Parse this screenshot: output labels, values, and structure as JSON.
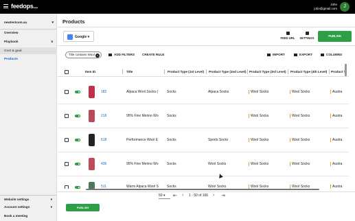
{
  "topbar": {
    "logo": "feedops...",
    "user_name": "John",
    "user_email": "john@gmail.com",
    "avatar_initial": "J"
  },
  "sidebar": {
    "site": "newtestcom.au",
    "items": [
      {
        "label": "Overview",
        "count": ""
      },
      {
        "label": "Playbook",
        "count": "5"
      },
      {
        "label": "Cost & goal",
        "count": ""
      },
      {
        "label": "Products",
        "count": ""
      }
    ],
    "bottom": [
      {
        "label": "Website settings"
      },
      {
        "label": "Account settings"
      },
      {
        "label": "Book a meeting"
      }
    ]
  },
  "page": {
    "title": "Products"
  },
  "toolbar": {
    "channel": "Google",
    "feed_url": "FEED URL",
    "settings": "SETTINGS",
    "publish": "PUBLISH"
  },
  "filters": {
    "chip": "Title contains Wool",
    "add_filters": "ADD FILTERS",
    "create_rule": "CREATE RULE",
    "import": "IMPORT",
    "export": "EXPORT",
    "columns": "COLUMNS"
  },
  "table": {
    "headers": [
      "Item ID",
      "Title",
      "Product Type (1st Level)",
      "Product Type (2nd Level)",
      "Product Type (3rd Level)",
      "Product Type (4th Level)",
      "Product T"
    ],
    "rows": [
      {
        "id": "182",
        "title": "Alpaca Wool Socks (",
        "l1": "Socks",
        "l2": "Alpaca Socks",
        "l3": "Wool Socks",
        "l4": "Wool Socks",
        "l5": "Austra",
        "thumb_color": "#c0304a"
      },
      {
        "id": "218",
        "title": "95% Fine Merino Wo",
        "l1": "Socks",
        "l2": "",
        "l3": "Wool Socks",
        "l4": "Wool Socks",
        "l5": "Austra",
        "thumb_color": "#b84a5a"
      },
      {
        "id": "518",
        "title": "Performance Wool E",
        "l1": "Socks",
        "l2": "Sports Socks",
        "l3": "Wool Socks",
        "l4": "Wool Socks",
        "l5": "Austra",
        "thumb_color": "#222222"
      },
      {
        "id": "436",
        "title": "95% Fine Merino Wo",
        "l1": "Socks",
        "l2": "Wool Socks",
        "l3": "Wool Socks",
        "l4": "Wool Socks",
        "l5": "Austra",
        "thumb_color": "#c04a5a"
      },
      {
        "id": "511",
        "title": "Warm Alpaca Wool S",
        "l1": "Socks",
        "l2": "Wool Socks",
        "l3": "Wool Socks",
        "l4": "Wool Socks",
        "l5": "Austra",
        "thumb_color": "#4a7a5a"
      }
    ]
  },
  "pagination": {
    "page_size": "50",
    "range": "1 - 50 of 166"
  },
  "footer": {
    "publish": "PUBLISH"
  },
  "colors": {
    "accent_green": "#2e9e47",
    "link_blue": "#1565c0",
    "bar_orange": "#f0a020"
  }
}
